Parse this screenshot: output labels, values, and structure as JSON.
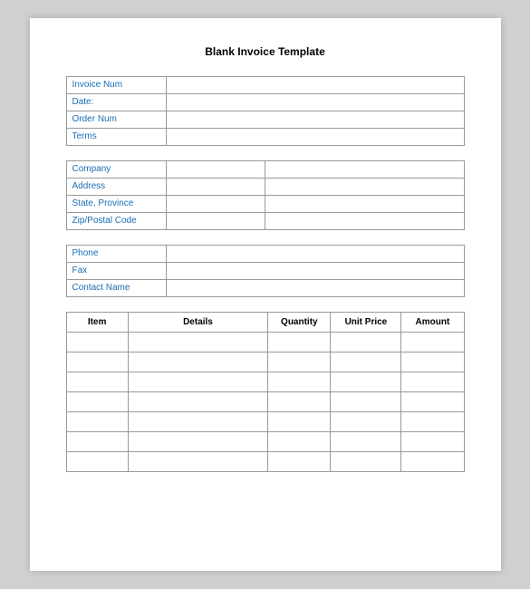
{
  "title": "Blank Invoice Template",
  "invoice_section": {
    "fields": [
      {
        "label": "Invoice Num",
        "value": ""
      },
      {
        "label": "Date:",
        "value": ""
      },
      {
        "label": "Order Num",
        "value": ""
      },
      {
        "label": "Terms",
        "value": ""
      }
    ]
  },
  "address_section": {
    "rows": [
      {
        "left_label": "Company",
        "left_value": "",
        "right_label": "",
        "right_value": ""
      },
      {
        "left_label": "Address",
        "left_value": "",
        "right_label": "",
        "right_value": ""
      },
      {
        "left_label": "State, Province",
        "left_value": "",
        "right_label": "",
        "right_value": ""
      },
      {
        "left_label": "Zip/Postal Code",
        "left_value": "",
        "right_label": "",
        "right_value": ""
      }
    ]
  },
  "contact_section": {
    "fields": [
      {
        "label": "Phone",
        "value": ""
      },
      {
        "label": "Fax",
        "value": ""
      },
      {
        "label": "Contact Name",
        "value": ""
      }
    ]
  },
  "table": {
    "headers": [
      "Item",
      "Details",
      "Quantity",
      "Unit Price",
      "Amount"
    ],
    "rows": [
      [
        "",
        "",
        "",
        "",
        ""
      ],
      [
        "",
        "",
        "",
        "",
        ""
      ],
      [
        "",
        "",
        "",
        "",
        ""
      ],
      [
        "",
        "",
        "",
        "",
        ""
      ],
      [
        "",
        "",
        "",
        "",
        ""
      ],
      [
        "",
        "",
        "",
        "",
        ""
      ],
      [
        "",
        "",
        "",
        "",
        ""
      ]
    ]
  }
}
